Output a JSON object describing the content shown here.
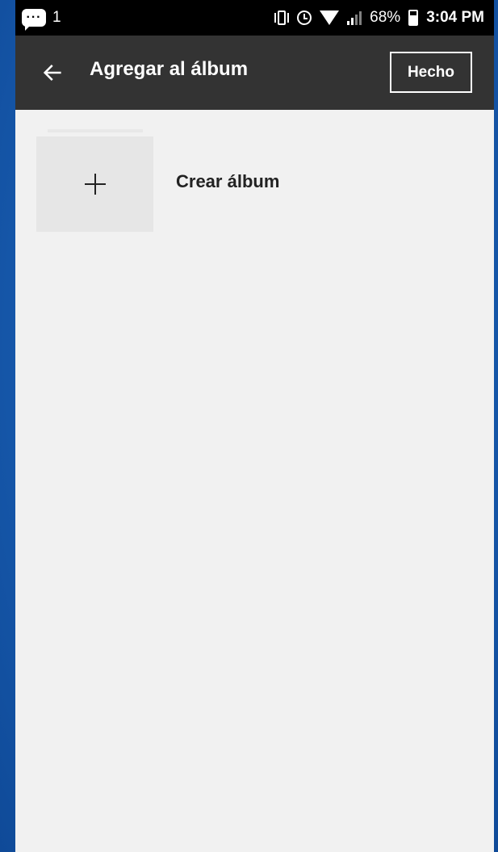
{
  "status_bar": {
    "notification_count": "1",
    "battery_percent": "68%",
    "battery_level": 0.68,
    "time": "3:04 PM",
    "icons": [
      "message-icon",
      "vibrate-icon",
      "alarm-icon",
      "wifi-icon",
      "signal-icon",
      "battery-icon"
    ]
  },
  "app_bar": {
    "back_icon": "arrow-left-icon",
    "title": "Agregar al álbum",
    "done_label": "Hecho",
    "background_color": "#333333"
  },
  "content": {
    "create_album_label": "Crear álbum",
    "create_icon": "plus-icon",
    "background_color": "#f1f1f1"
  }
}
